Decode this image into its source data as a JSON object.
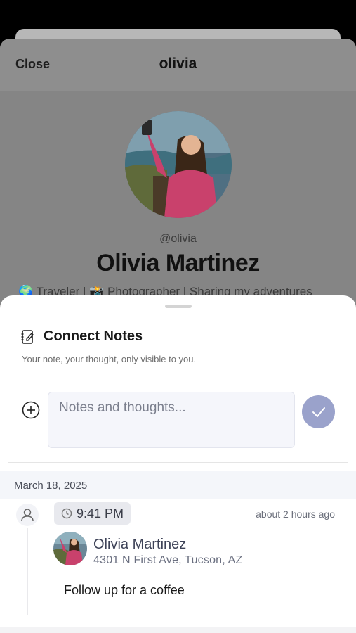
{
  "profile": {
    "close_label": "Close",
    "title": "olivia",
    "handle": "@olivia",
    "full_name": "Olivia Martinez",
    "bio": "🌍 Traveler | 📸 Photographer | Sharing my adventures"
  },
  "notes": {
    "title": "Connect Notes",
    "subtitle": "Your note, your thought, only visible to you.",
    "input_placeholder": "Notes and thoughts...",
    "input_value": "",
    "date": "March 18, 2025",
    "entry": {
      "time": "9:41 PM",
      "relative_time": "about 2 hours ago",
      "name": "Olivia Martinez",
      "address": "4301 N First Ave, Tucson, AZ",
      "text": "Follow up for a coffee"
    }
  },
  "icons": {
    "notes": "edit-note-icon",
    "add": "plus-circle-icon",
    "submit": "checkmark-icon",
    "user": "user-icon",
    "clock": "clock-icon"
  },
  "colors": {
    "submit_button": "#9aa2cb",
    "input_background": "#f5f6fb",
    "date_bar": "#f4f6fa",
    "time_chip": "#e8e9ee",
    "overlay": "#858585"
  }
}
